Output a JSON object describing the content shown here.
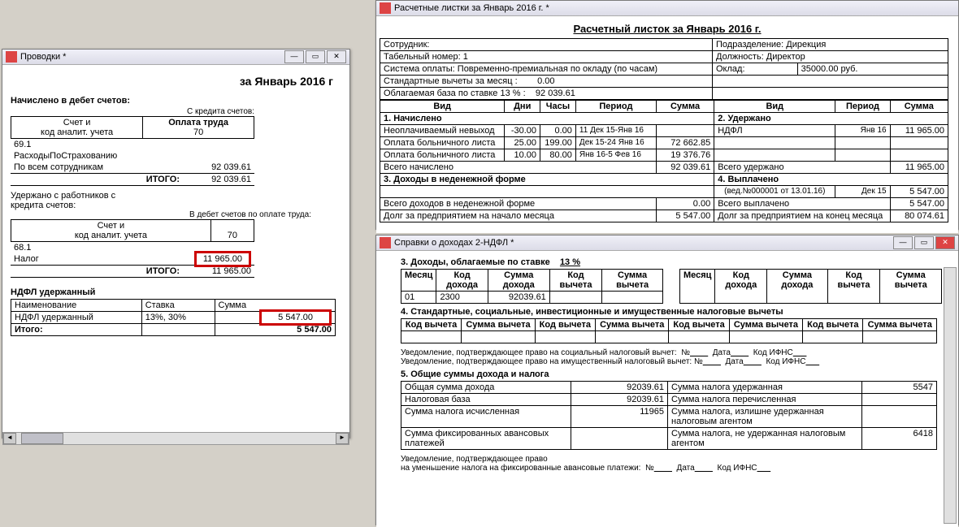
{
  "win1": {
    "title": "Проводки *",
    "heading": "за Январь 2016 г",
    "sec1": "Начислено в дебет счетов:",
    "sub1": "С кредита счетов:",
    "h1a": "Счет и",
    "h1b": "код аналит. учета",
    "h1c": "Оплата труда",
    "h1d": "70",
    "r1a": "69.1",
    "r1b": "РасходыПоСтрахованию",
    "r1c": "По всем сотрудникам",
    "r1v": "92 039.61",
    "itogo": "ИТОГО:",
    "itogo1": "92 039.61",
    "sec2a": "Удержано с работников с",
    "sec2b": "кредита счетов:",
    "sub2": "В дебет счетов по оплате труда:",
    "h2a": "Счет и",
    "h2b": "код аналит. учета",
    "h2c": "70",
    "r2a": "68.1",
    "r2b": "Налог",
    "r2v": "11 965.00",
    "itogo2": "11 965.00",
    "sec3": "НДФЛ удержанный",
    "h3a": "Наименование",
    "h3b": "Ставка",
    "h3c": "Сумма",
    "r3a": "НДФЛ удержанный",
    "r3b": "13%, 30%",
    "r3v": "5 547.00",
    "itogo3l": "Итого:",
    "itogo3": "5 547.00"
  },
  "win2": {
    "title": "Расчетные листки за Январь 2016 г. *",
    "heading": "Расчетный листок за Январь 2016 г.",
    "lbl_emp": "Сотрудник:",
    "lbl_div": "Подразделение: Дирекция",
    "lbl_tab": "Табельный номер: 1",
    "lbl_pos": "Должность: Директор",
    "lbl_pay": "Система оплаты: Повременно-премиальная по окладу (по часам)",
    "lbl_sal": "Оклад:",
    "sal": "35000.00 руб.",
    "lbl_std": "Стандартные вычеты за месяц :",
    "std": "0.00",
    "lbl_base": "Облагаемая база по ставке 13 % :",
    "base": "92 039.61",
    "th": {
      "vid": "Вид",
      "dni": "Дни",
      "chasy": "Часы",
      "period": "Период",
      "summa": "Сумма",
      "vid2": "Вид",
      "period2": "Период",
      "summa2": "Сумма"
    },
    "s1": "1. Начислено",
    "s2": "2. Удержано",
    "rows": [
      {
        "n": "Неоплачиваемый невыход",
        "d": "-30.00",
        "c": "0.00",
        "p": "11 Дек 15-Янв 16",
        "s": "",
        "n2": "НДФЛ",
        "p2": "Янв 16",
        "s2": "11 965.00"
      },
      {
        "n": "Оплата больничного листа",
        "d": "25.00",
        "c": "199.00",
        "p": "Дек 15-24 Янв 16",
        "s": "72 662.85",
        "n2": "",
        "p2": "",
        "s2": ""
      },
      {
        "n": "Оплата больничного листа",
        "d": "10.00",
        "c": "80.00",
        "p": "Янв 16-5 Фев 16",
        "s": "19 376.76",
        "n2": "",
        "p2": "",
        "s2": ""
      }
    ],
    "tot1l": "Всего начислено",
    "tot1": "92 039.61",
    "tot2l": "Всего удержано",
    "tot2": "11 965.00",
    "s3": "3. Доходы в неденежной форме",
    "s4": "4. Выплачено",
    "r4": "(вед.№000001 от 13.01.16)",
    "r4p": "Дек 15",
    "r4s": "5 547.00",
    "tot3l": "Всего доходов в неденежной форме",
    "tot3": "0.00",
    "tot4l": "Всего выплачено",
    "tot4": "5 547.00",
    "debt1l": "Долг за предприятием на начало месяца",
    "debt1": "5 547.00",
    "debt2l": "Долг за предприятием  на  конец  месяца",
    "debt2": "80 074.61"
  },
  "win3": {
    "title": "Справки о доходах 2-НДФЛ *",
    "s3": "3. Доходы, облагаемые по ставке",
    "pct": "13     %",
    "th1": {
      "m": "Месяц",
      "kd": "Код дохода",
      "sd": "Сумма дохода",
      "kv": "Код вычета",
      "sv": "Сумма вычета"
    },
    "row1": {
      "m": "01",
      "kd": "2300",
      "sd": "92039.61",
      "kv": "",
      "sv": ""
    },
    "s4": "4. Стандартные, социальные, инвестиционные и имущественные налоговые вычеты",
    "th2a": "Код вычета",
    "th2b": "Сумма вычета",
    "n1": "Уведомление, подтверждающее право на социальный налоговый вычет:",
    "no": "№",
    "date": "Дата",
    "ifns": "Код ИФНС",
    "n2": "Уведомление, подтверждающее право на имущественный налоговый вычет:",
    "s5": "5. Общие суммы дохода и налога",
    "r5a": "Общая сумма дохода",
    "r5av": "92039.61",
    "r5b": "Сумма налога удержанная",
    "r5bv": "5547",
    "r5c": "Налоговая база",
    "r5cv": "92039.61",
    "r5d": "Сумма налога перечисленная",
    "r5dv": "",
    "r5e": "Сумма налога исчисленная",
    "r5ev": "11965",
    "r5f": "Сумма налога, излишне удержанная налоговым агентом",
    "r5fv": "",
    "r5g": "Сумма фиксированных авансовых платежей",
    "r5gv": "",
    "r5h": "Сумма налога, не удержанная налоговым агентом",
    "r5hv": "6418",
    "n3a": "Уведомление, подтверждающее право",
    "n3b": "на уменьшение налога на фиксированные авансовые платежи:"
  }
}
